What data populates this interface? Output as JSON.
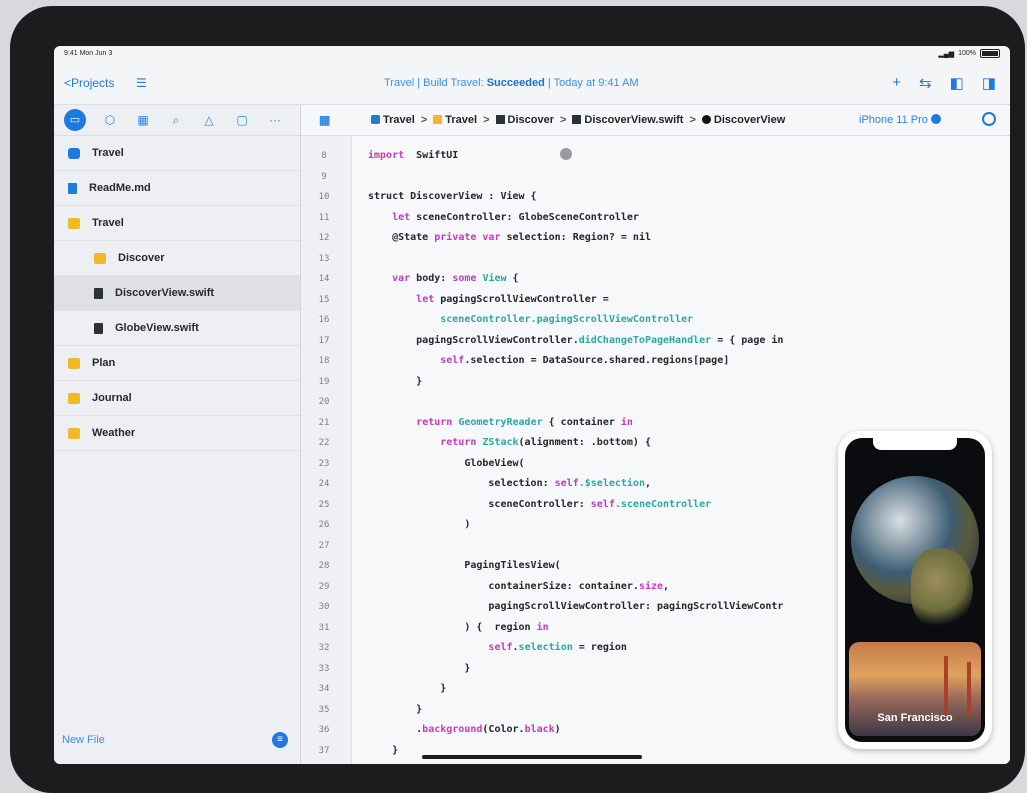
{
  "status_bar": {
    "time": "9:41 Mon Jun 3",
    "battery": "100%"
  },
  "toolbar": {
    "back_label": "Projects",
    "build_prefix": "Travel | Build Travel: ",
    "build_result": "Succeeded",
    "build_suffix": " | Today at 9:41 AM",
    "icons": [
      "add-icon",
      "swap-icon",
      "sidebar-left-icon",
      "sidebar-right-icon"
    ]
  },
  "navigator": {
    "tabs": [
      "folder-icon",
      "cube-icon",
      "grid-icon",
      "search-icon",
      "warning-icon",
      "message-icon",
      "more-icon"
    ],
    "items": [
      {
        "label": "Travel",
        "icon": "project-icon",
        "indent": 0
      },
      {
        "label": "ReadMe.md",
        "icon": "doc-icon",
        "indent": 0
      },
      {
        "label": "Travel",
        "icon": "folder-icon",
        "indent": 0
      },
      {
        "label": "Discover",
        "icon": "folder-icon",
        "indent": 1
      },
      {
        "label": "DiscoverView.swift",
        "icon": "file-icon",
        "indent": 1,
        "selected": true
      },
      {
        "label": "GlobeView.swift",
        "icon": "file-icon",
        "indent": 1
      },
      {
        "label": "Plan",
        "icon": "folder-icon",
        "indent": 0
      },
      {
        "label": "Journal",
        "icon": "folder-icon",
        "indent": 0
      },
      {
        "label": "Weather",
        "icon": "folder-icon",
        "indent": 0
      }
    ],
    "new_file_label": "New File"
  },
  "jumpbar": {
    "crumbs": [
      "Travel",
      "Travel",
      "Discover",
      "DiscoverView.swift",
      "DiscoverView"
    ],
    "device": "iPhone 11 Pro"
  },
  "code": {
    "lines": [
      {
        "n": "8",
        "segs": [
          [
            "kw",
            "import"
          ],
          [
            "",
            "  SwiftUI"
          ]
        ]
      },
      {
        "n": "9",
        "segs": []
      },
      {
        "n": "10",
        "segs": [
          [
            "",
            "struct DiscoverView : View {"
          ]
        ]
      },
      {
        "n": "11",
        "segs": [
          [
            "",
            "    "
          ],
          [
            "kw",
            "let"
          ],
          [
            "",
            " sceneController: GlobeSceneController"
          ]
        ]
      },
      {
        "n": "12",
        "segs": [
          [
            "",
            "    @State "
          ],
          [
            "kw",
            "private var"
          ],
          [
            "",
            " selection: Region? = nil"
          ]
        ]
      },
      {
        "n": "13",
        "segs": []
      },
      {
        "n": "14",
        "segs": [
          [
            "",
            "    "
          ],
          [
            "kw",
            "var"
          ],
          [
            "",
            " body: "
          ],
          [
            "kw",
            "some"
          ],
          [
            "",
            " "
          ],
          [
            "ty",
            "View"
          ],
          [
            "",
            " {"
          ]
        ]
      },
      {
        "n": "15",
        "segs": [
          [
            "",
            "        "
          ],
          [
            "kw",
            "let"
          ],
          [
            "",
            " pagingScrollViewController ="
          ]
        ]
      },
      {
        "n": "16",
        "segs": [
          [
            "",
            "            "
          ],
          [
            "fn",
            "sceneController.pagingScrollViewController"
          ]
        ]
      },
      {
        "n": "17",
        "segs": [
          [
            "",
            "        pagingScrollViewController."
          ],
          [
            "fn",
            "didChangeToPageHandler"
          ],
          [
            "",
            " = { page in"
          ]
        ]
      },
      {
        "n": "18",
        "segs": [
          [
            "",
            "            "
          ],
          [
            "kw",
            "self"
          ],
          [
            "",
            ".selection = DataSource.shared.regions[page]"
          ]
        ]
      },
      {
        "n": "19",
        "segs": [
          [
            "",
            "        }"
          ]
        ]
      },
      {
        "n": "20",
        "segs": []
      },
      {
        "n": "21",
        "segs": [
          [
            "",
            "        "
          ],
          [
            "kw",
            "return"
          ],
          [
            "",
            " "
          ],
          [
            "ty",
            "GeometryReader"
          ],
          [
            "",
            " { container "
          ],
          [
            "kw",
            "in"
          ]
        ]
      },
      {
        "n": "22",
        "segs": [
          [
            "",
            "            "
          ],
          [
            "kw",
            "return"
          ],
          [
            "",
            " "
          ],
          [
            "ty",
            "ZStack"
          ],
          [
            "",
            "(alignment: .bottom) {"
          ]
        ]
      },
      {
        "n": "23",
        "segs": [
          [
            "",
            "                GlobeView("
          ]
        ]
      },
      {
        "n": "24",
        "segs": [
          [
            "",
            "                    selection: "
          ],
          [
            "kw",
            "self"
          ],
          [
            "fn",
            ".$selection"
          ],
          [
            "",
            ","
          ]
        ]
      },
      {
        "n": "25",
        "segs": [
          [
            "",
            "                    sceneController: "
          ],
          [
            "kw",
            "self"
          ],
          [
            "fn",
            ".sceneController"
          ]
        ]
      },
      {
        "n": "26",
        "segs": [
          [
            "",
            "                )"
          ]
        ]
      },
      {
        "n": "27",
        "segs": []
      },
      {
        "n": "28",
        "segs": [
          [
            "",
            "                PagingTilesView("
          ]
        ]
      },
      {
        "n": "29",
        "segs": [
          [
            "",
            "                    containerSize: container."
          ],
          [
            "kw",
            "size"
          ],
          [
            "",
            ","
          ]
        ]
      },
      {
        "n": "30",
        "segs": [
          [
            "",
            "                    pagingScrollViewController: pagingScrollViewContr"
          ]
        ]
      },
      {
        "n": "31",
        "segs": [
          [
            "",
            "                ) {  region "
          ],
          [
            "kw",
            "in"
          ]
        ]
      },
      {
        "n": "32",
        "segs": [
          [
            "",
            "                    "
          ],
          [
            "kw",
            "self"
          ],
          [
            "",
            "."
          ],
          [
            "fn",
            "selection"
          ],
          [
            "",
            " = region"
          ]
        ]
      },
      {
        "n": "33",
        "segs": [
          [
            "",
            "                }"
          ]
        ]
      },
      {
        "n": "34",
        "segs": [
          [
            "",
            "            }"
          ]
        ]
      },
      {
        "n": "35",
        "segs": [
          [
            "",
            "        }"
          ]
        ]
      },
      {
        "n": "36",
        "segs": [
          [
            "",
            "        ."
          ],
          [
            "kw",
            "background"
          ],
          [
            "",
            "(Color."
          ],
          [
            "kw",
            "black"
          ],
          [
            "",
            ")"
          ]
        ]
      },
      {
        "n": "37",
        "segs": [
          [
            "",
            "    }"
          ]
        ]
      }
    ]
  },
  "preview": {
    "tile_label": "San Francisco"
  }
}
